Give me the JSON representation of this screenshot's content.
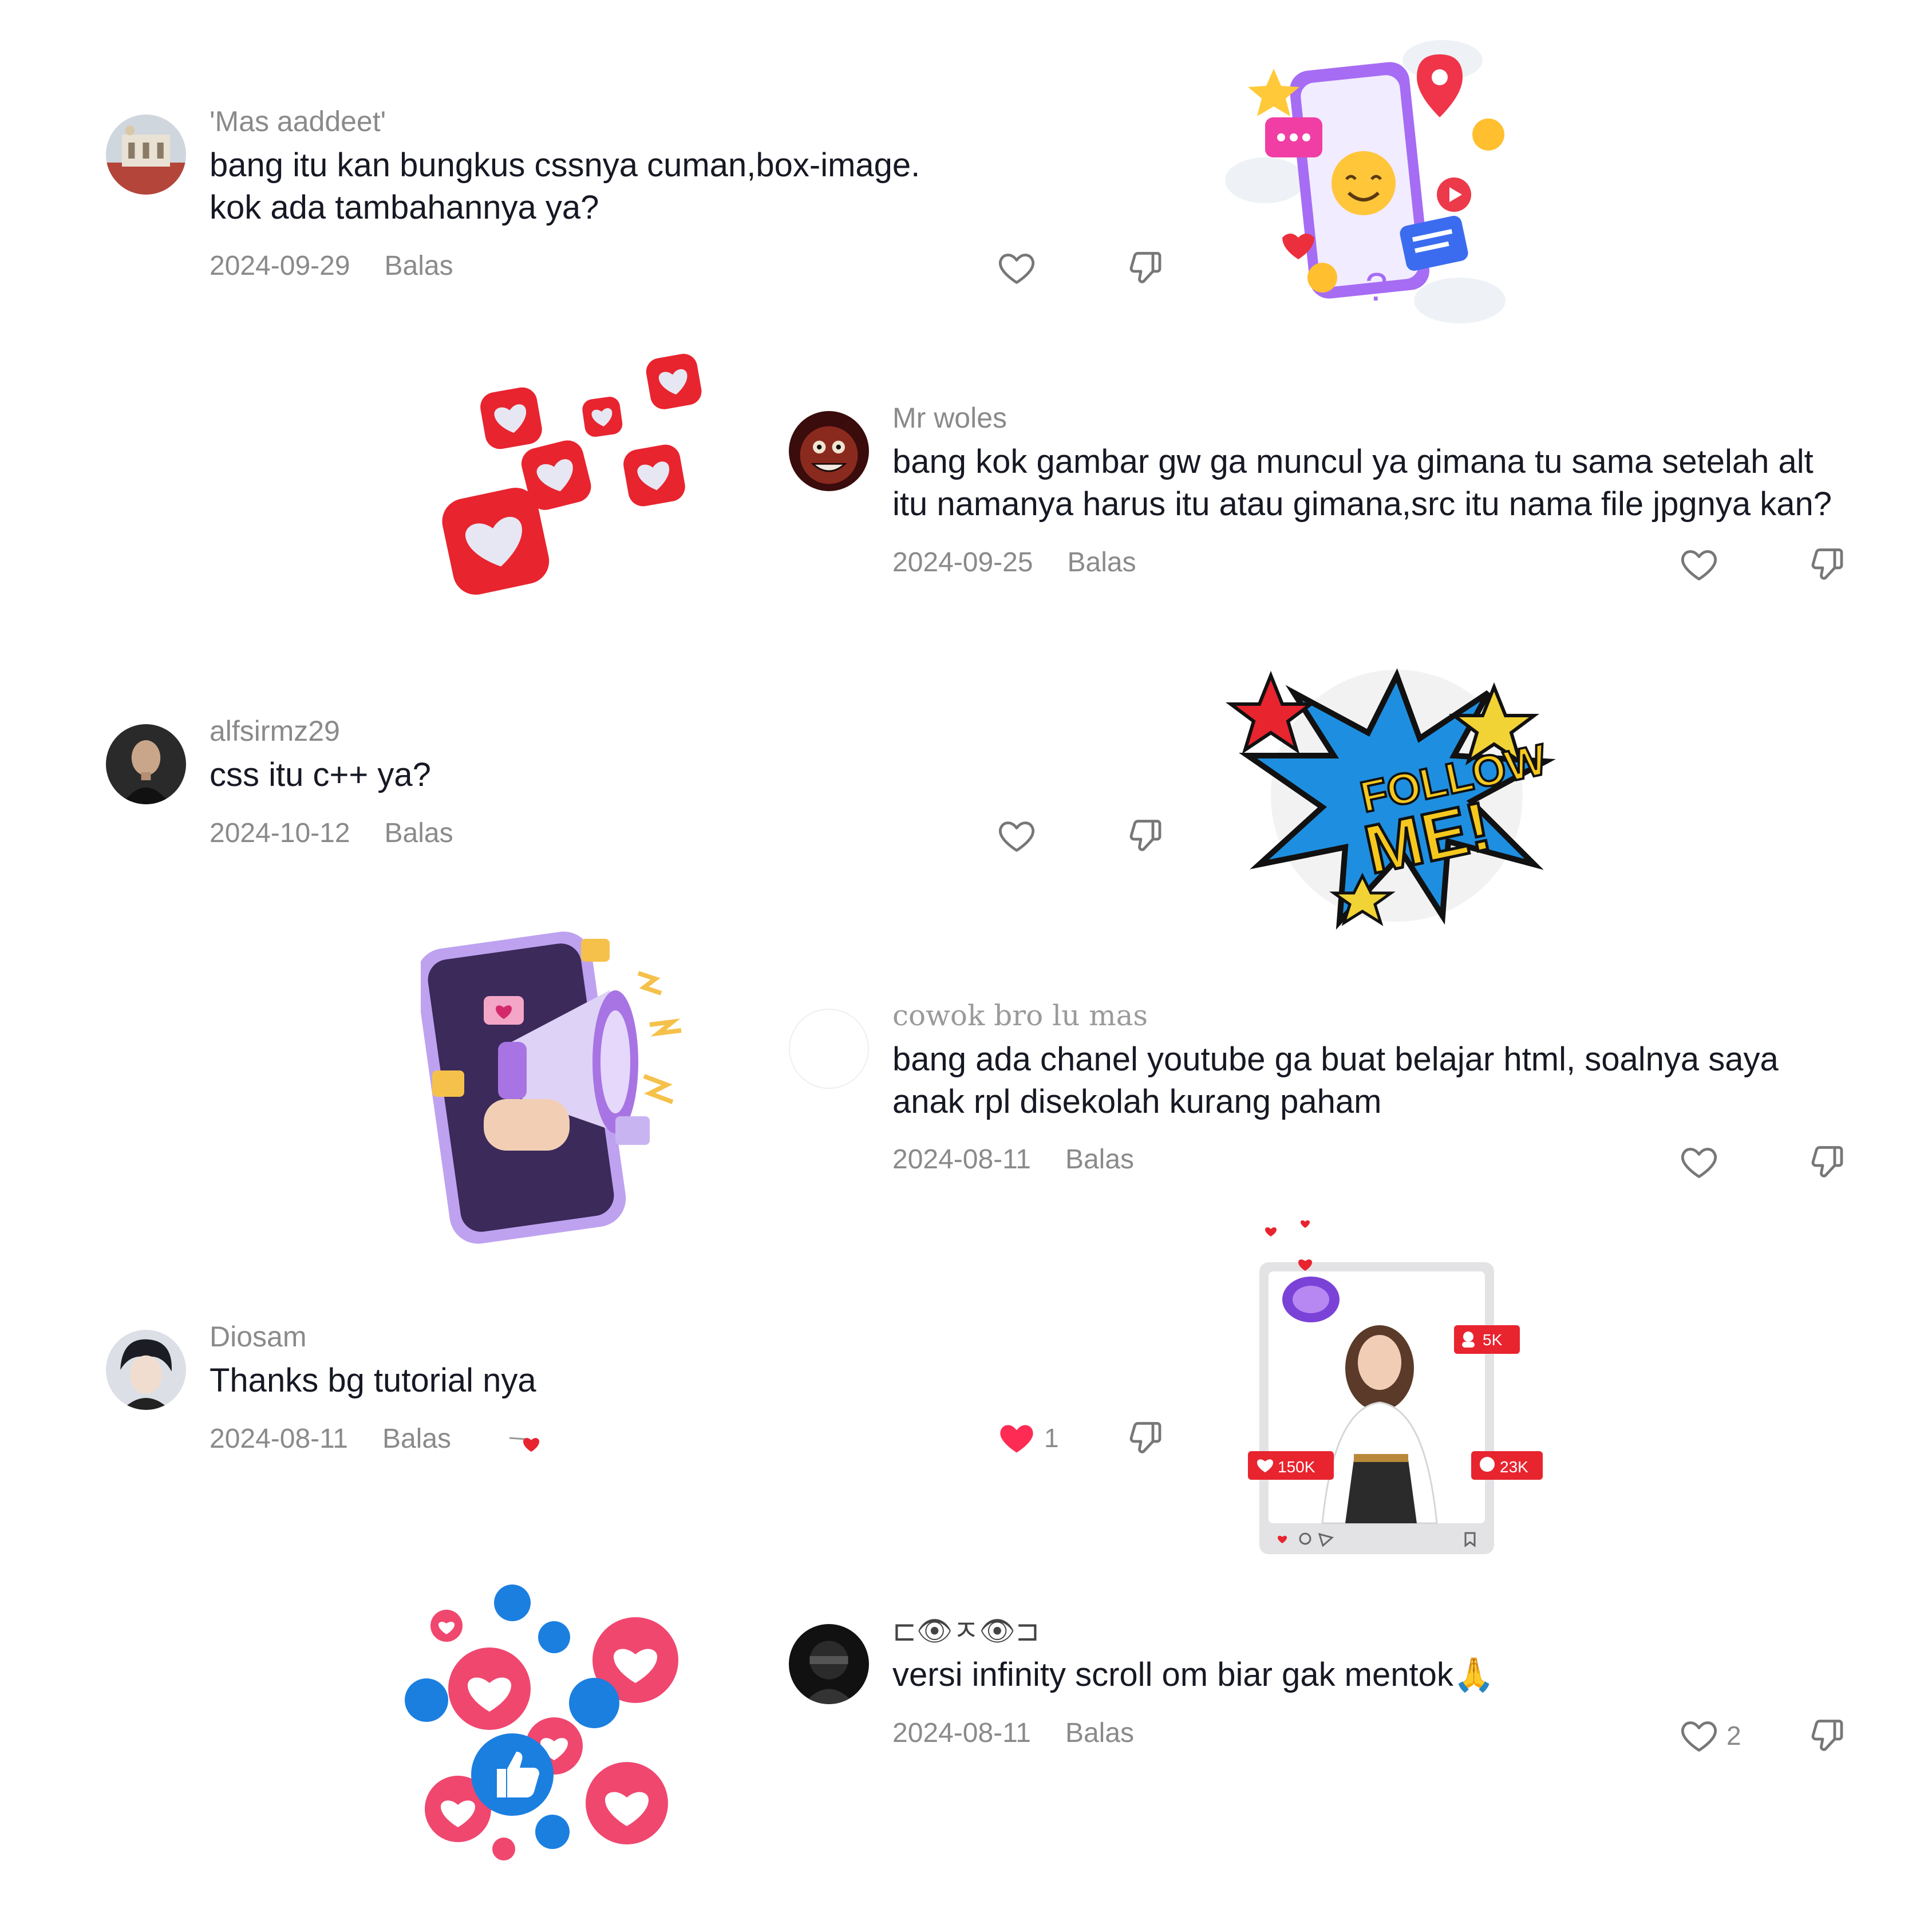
{
  "colors": {
    "text": "#161823",
    "muted": "#8a8a8a",
    "liked": "#fe2c55",
    "brand_red": "#e8242f",
    "brand_blue": "#1877f2"
  },
  "comments": [
    {
      "username": "'Mas aaddeet'",
      "text_line1": "bang itu kan bungkus cssnya cuman,box-image.",
      "text_line2": "kok ada tambahannya ya?",
      "date": "2024-09-29",
      "reply": "Balas",
      "likes": "",
      "liked": false
    },
    {
      "username": "Mr woles",
      "text_line1": "bang kok gambar gw ga muncul ya gimana tu sama setelah alt",
      "text_line2": "itu namanya harus itu atau gimana,src itu nama file jpgnya kan?",
      "date": "2024-09-25",
      "reply": "Balas",
      "likes": "",
      "liked": false
    },
    {
      "username": "alfsirmz29",
      "text_line1": "css itu c++ ya?",
      "text_line2": "",
      "date": "2024-10-12",
      "reply": "Balas",
      "likes": "",
      "liked": false
    },
    {
      "username": "cowok bro lu mas",
      "text_line1": "bang ada chanel youtube ga buat belajar html, soalnya saya",
      "text_line2": "anak rpl disekolah kurang paham",
      "date": "2024-08-11",
      "reply": "Balas",
      "likes": "",
      "liked": false
    },
    {
      "username": "Diosam",
      "text_line1": "Thanks bg tutorial nya",
      "text_line2": "",
      "date": "2024-08-11",
      "reply": "Balas",
      "likes": "1",
      "liked": true
    },
    {
      "username": "⊏👁ㅈ👁⊐",
      "text_line1": "versi infinity scroll om biar gak mentok🙏",
      "text_line2": "",
      "date": "2024-08-11",
      "reply": "Balas",
      "likes": "2",
      "liked": false
    }
  ],
  "stickers": {
    "follow_line1": "FOLLOW",
    "follow_line2": "ME!",
    "badge_followers": "5K",
    "badge_likes": "150K",
    "badge_comments": "23K"
  },
  "icons": [
    "heart-outline-icon",
    "heart-filled-icon",
    "thumbs-down-icon",
    "thumbs-up-icon"
  ]
}
